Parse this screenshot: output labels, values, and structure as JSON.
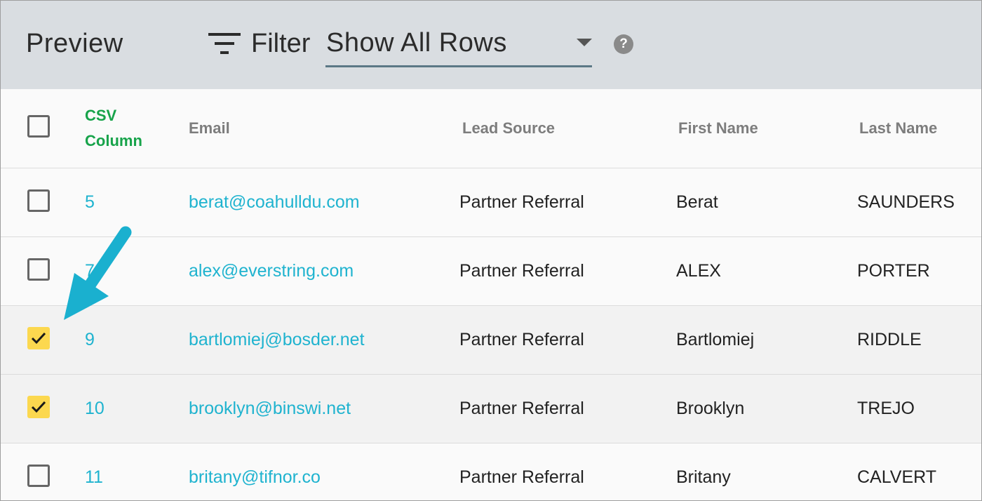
{
  "header": {
    "title": "Preview",
    "filter_label": "Filter",
    "filter_select_value": "Show All Rows",
    "help_glyph": "?"
  },
  "table": {
    "columns": {
      "csv_line1": "CSV",
      "csv_line2": "Column",
      "email": "Email",
      "lead_source": "Lead Source",
      "first_name": "First Name",
      "last_name": "Last Name"
    },
    "rows": [
      {
        "checked": false,
        "csv": "5",
        "email": "berat@coahulldu.com",
        "lead_source": "Partner Referral",
        "first_name": "Berat",
        "last_name": "SAUNDERS"
      },
      {
        "checked": false,
        "csv": "7",
        "email": "alex@everstring.com",
        "lead_source": "Partner Referral",
        "first_name": "ALEX",
        "last_name": "PORTER"
      },
      {
        "checked": true,
        "csv": "9",
        "email": "bartlomiej@bosder.net",
        "lead_source": "Partner Referral",
        "first_name": "Bartlomiej",
        "last_name": "RIDDLE"
      },
      {
        "checked": true,
        "csv": "10",
        "email": "brooklyn@binswi.net",
        "lead_source": "Partner Referral",
        "first_name": "Brooklyn",
        "last_name": "TREJO"
      },
      {
        "checked": false,
        "csv": "11",
        "email": "britany@tifnor.co",
        "lead_source": "Partner Referral",
        "first_name": "Britany",
        "last_name": "CALVERT"
      }
    ]
  },
  "colors": {
    "header_bg": "#d9dde1",
    "accent_link": "#1fb3cf",
    "csv_header": "#17a34a",
    "checkbox_checked": "#fcd84f",
    "arrow": "#1ab0cf"
  },
  "icons": {
    "filter": "filter-lines-icon",
    "dropdown": "caret-down-icon",
    "help": "help-circle-icon",
    "check": "checkmark-icon",
    "annotation": "pointer-arrow-icon"
  }
}
